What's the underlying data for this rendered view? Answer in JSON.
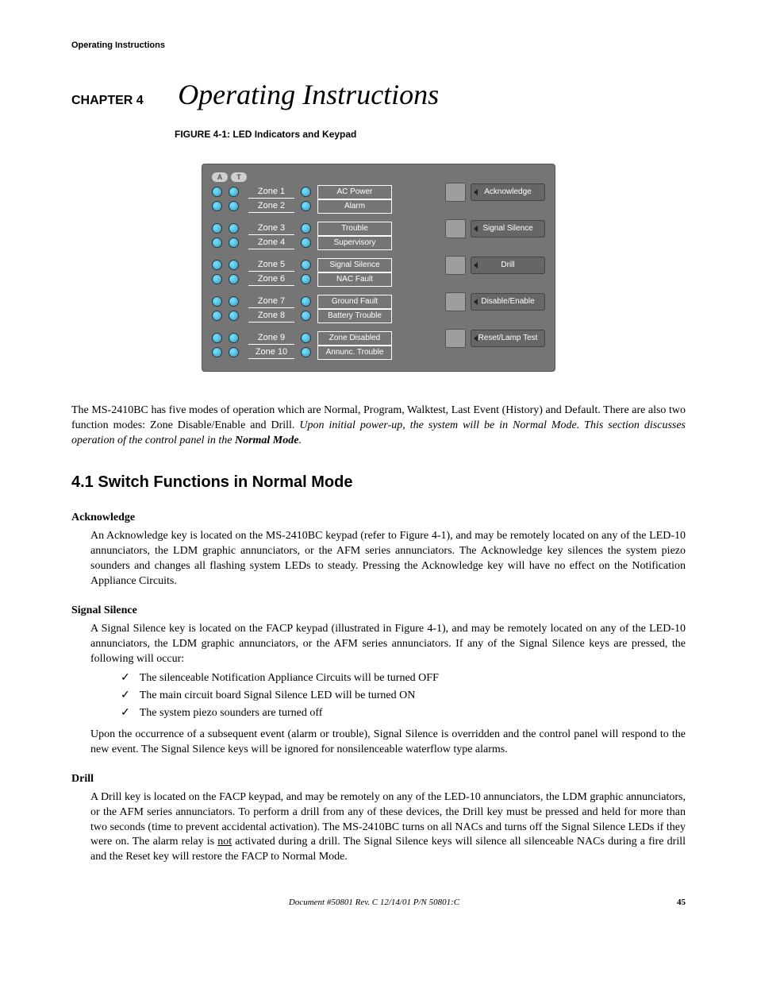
{
  "running_header": "Operating Instructions",
  "chapter": {
    "label": "CHAPTER 4",
    "title": "Operating Instructions"
  },
  "figure": {
    "label": "FIGURE 4-1:",
    "title": "LED Indicators and Keypad"
  },
  "panel": {
    "at_a": "A",
    "at_t": "T",
    "zone_rows": [
      {
        "zone": "Zone 1",
        "status": "AC Power"
      },
      {
        "zone": "Zone 2",
        "status": "Alarm"
      },
      {
        "zone": "Zone 3",
        "status": "Trouble"
      },
      {
        "zone": "Zone 4",
        "status": "Supervisory"
      },
      {
        "zone": "Zone 5",
        "status": "Signal Silence"
      },
      {
        "zone": "Zone 6",
        "status": "NAC Fault"
      },
      {
        "zone": "Zone 7",
        "status": "Ground Fault"
      },
      {
        "zone": "Zone 8",
        "status": "Battery Trouble"
      },
      {
        "zone": "Zone 9",
        "status": "Zone Disabled"
      },
      {
        "zone": "Zone 10",
        "status": "Annunc. Trouble"
      }
    ],
    "buttons": [
      "Acknowledge",
      "Signal Silence",
      "Drill",
      "Disable/Enable",
      "Reset/Lamp Test"
    ]
  },
  "intro": {
    "plain1": "The MS-2410BC has five modes of operation which are Normal, Program, Walktest, Last Event (History) and Default.  There are also two function modes: Zone Disable/Enable and Drill.  ",
    "italic1": "Upon initial power-up, the system will be in Normal Mode.  This section discusses operation of the control panel in the ",
    "bolditalic": "Normal Mode",
    "italic2": "."
  },
  "section41": "4.1   Switch Functions in Normal Mode",
  "ack": {
    "h": "Acknowledge",
    "p": "An Acknowledge key is located on the MS-2410BC keypad (refer to Figure 4-1), and may be remotely located on any of the LED-10 annunciators, the LDM graphic annunciators, or the AFM series annunciators.  The Acknowledge key silences the system piezo sounders and changes all flashing system LEDs to steady.  Pressing the Acknowledge key will have no effect on the Notification Appliance Circuits."
  },
  "sigsil": {
    "h": "Signal Silence",
    "p1": "A Signal Silence key is located on the FACP keypad (illustrated in Figure 4-1), and may be remotely located on any of the LED-10 annunciators, the LDM graphic annunciators, or the AFM series annunciators.  If any of the Signal Silence keys are pressed, the following will occur:",
    "bullets": [
      "The silenceable Notification Appliance Circuits will be turned OFF",
      "The main circuit board Signal Silence LED will be turned ON",
      "The system piezo sounders are turned off"
    ],
    "p2a": "Upon the occurrence of a subsequent event (alarm or trouble), Signal Silence is overridden and the control panel will respond to the new event.  ",
    "p2b": "The Signal Silence keys will be ignored for nonsilenceable waterflow type alarms."
  },
  "drill": {
    "h": "Drill",
    "p_a": "A Drill key is located on the FACP keypad, and may be remotely on any of the LED-10 annunciators, the LDM graphic annunciators, or the AFM series annunciators.  To perform a drill from any of these devices, the Drill key must be pressed and held for more than two seconds (time to prevent accidental activation).  The MS-2410BC turns on all NACs and turns off the Signal Silence LEDs if they were on.  The alarm relay is ",
    "p_not": "not",
    "p_b": " activated during a drill.  The Signal Silence keys will silence all silenceable NACs during a fire drill and the Reset key will restore the FACP to Normal Mode."
  },
  "footer": {
    "doc": "Document #50801   Rev. C   12/14/01   P/N 50801:C",
    "page": "45"
  }
}
